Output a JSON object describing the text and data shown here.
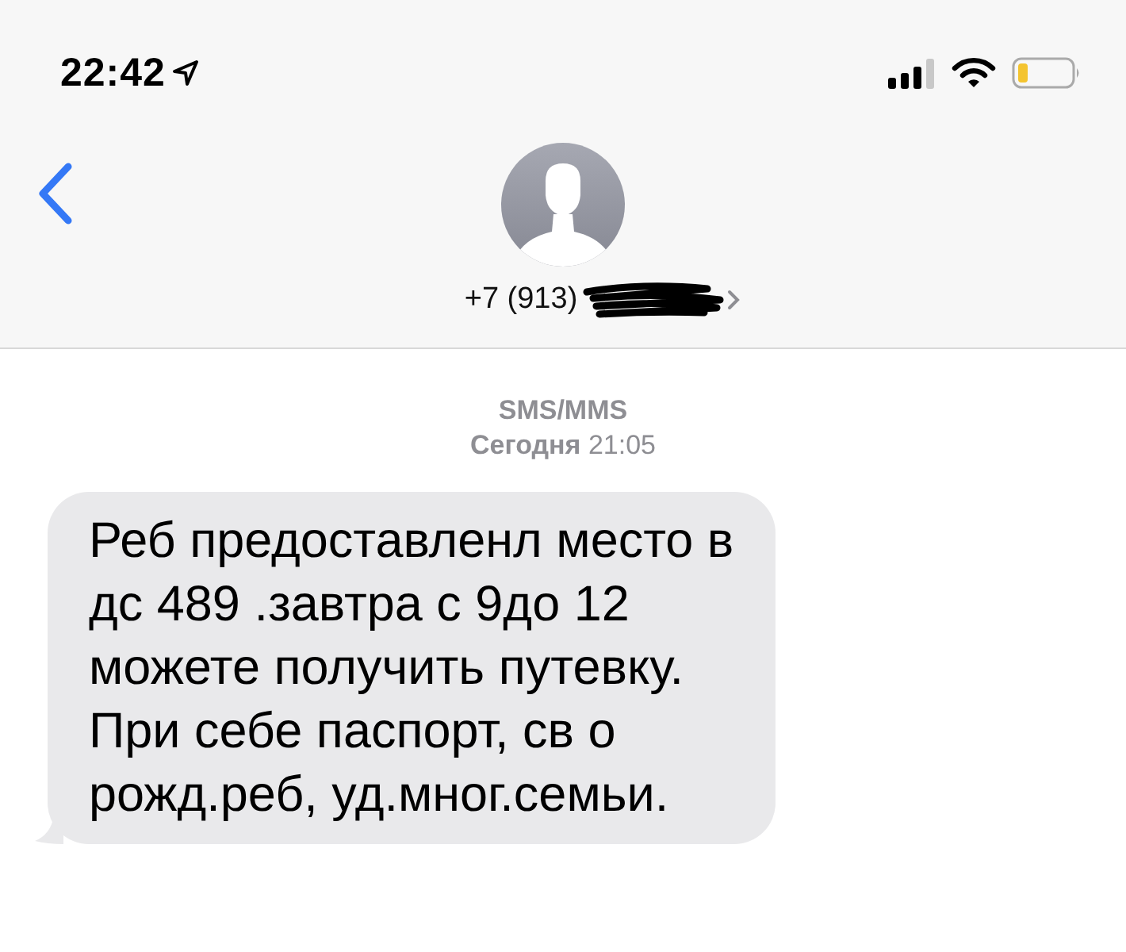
{
  "status_bar": {
    "time": "22:42"
  },
  "header": {
    "contact": "+7 (913)"
  },
  "thread": {
    "service": "SMS/MMS",
    "timestamp": "**Сегодня** 21:05"
  },
  "messages": [
    {
      "kind": "incoming",
      "text": "Реб предоставленл место в\nдс 489 .завтра с 9до 12\nможете получить путевку.\nПри себе паспорт, св о\nрожд.реб, уд.мног.семьи."
    }
  ]
}
